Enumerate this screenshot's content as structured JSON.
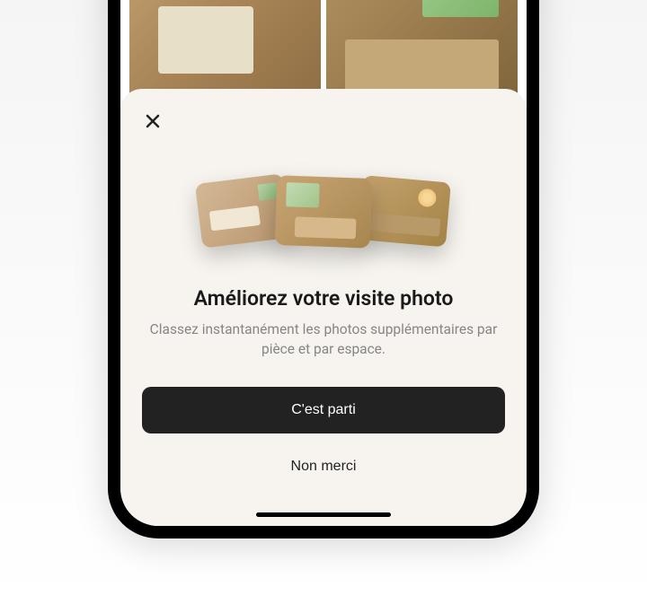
{
  "modal": {
    "title": "Améliorez votre visite photo",
    "subtitle": "Classez instantanément les photos supplémentaires par pièce et par espace.",
    "primary_button": "C'est parti",
    "secondary_button": "Non merci"
  },
  "icons": {
    "close": "close-icon"
  }
}
